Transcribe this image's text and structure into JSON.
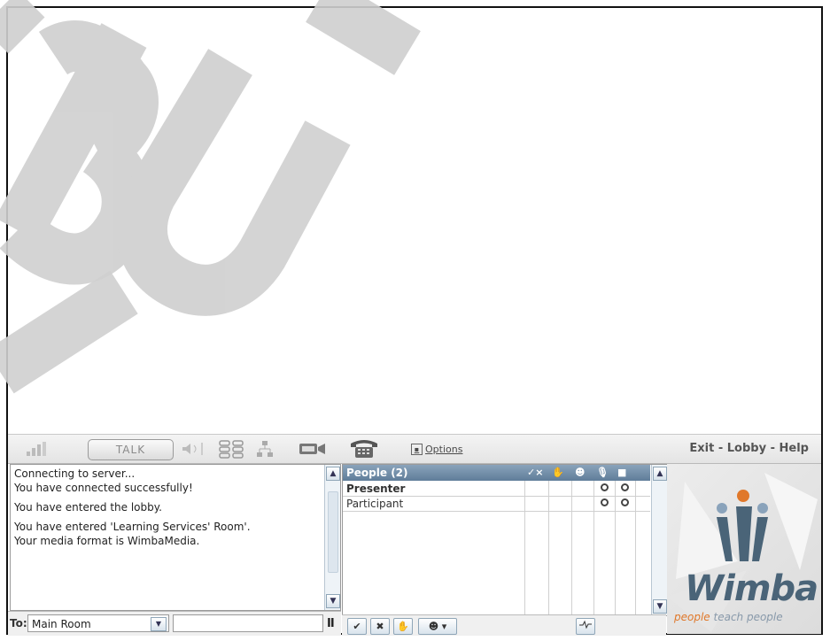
{
  "toolbar": {
    "talk_label": "TALK",
    "options_label": "Options",
    "nav": {
      "exit": "Exit",
      "lobby": "Lobby",
      "help": "Help",
      "sep": " - "
    }
  },
  "chat": {
    "messages": [
      "Connecting to server...",
      "You have connected successfully!",
      "You have entered the lobby.",
      "You have entered 'Learning Services' Room'.",
      "Your media format is WimbaMedia."
    ],
    "to_label": "To:",
    "to_value": "Main Room",
    "message_value": "",
    "pause_icon": "II"
  },
  "people": {
    "header": "People (2)",
    "header_icons": [
      "✓×",
      "hand-icon",
      "smile-icon",
      "mic-icon",
      "camera-icon"
    ],
    "rows": [
      {
        "name": "Presenter",
        "bold": true
      },
      {
        "name": "Participant",
        "bold": false
      }
    ],
    "buttons": [
      "✔",
      "✖",
      "hand-icon",
      "☻ ▾",
      "activity-icon"
    ]
  },
  "logo": {
    "word": "Wimba",
    "tagline_part1": "people",
    "tagline_part2": " teach people"
  },
  "watermark": {
    "text": "BU"
  },
  "colors": {
    "header_blue": "#5f7d99",
    "logo_blue": "#4a6478",
    "logo_orange": "#e0782a"
  }
}
